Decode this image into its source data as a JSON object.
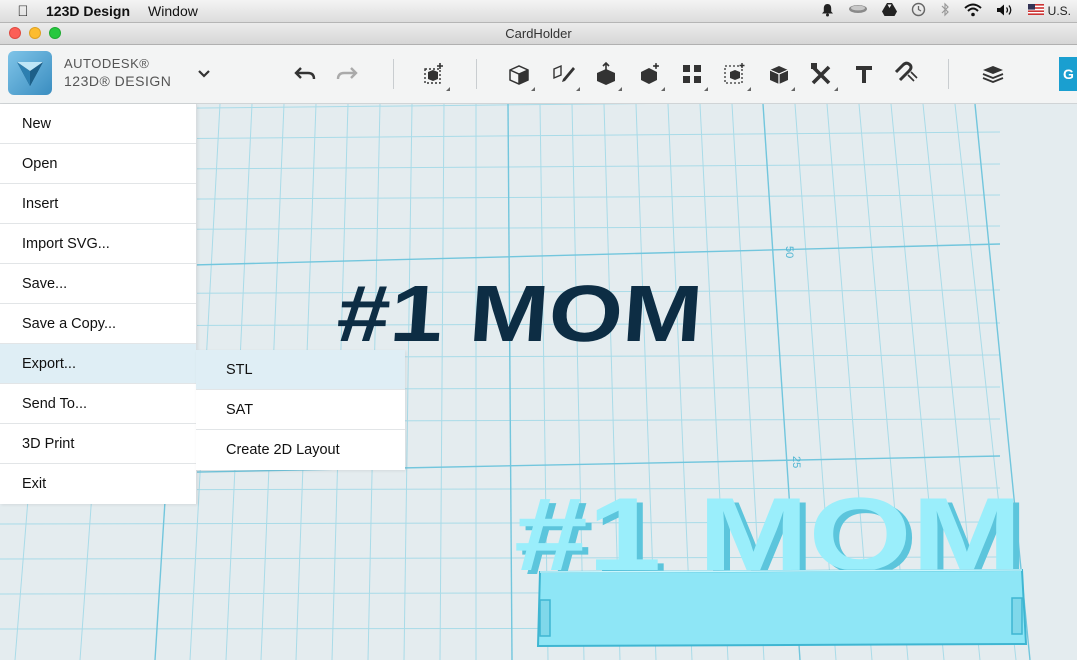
{
  "menubar": {
    "app_name": "123D Design",
    "items": [
      "Window"
    ],
    "input_source": "U.S."
  },
  "window": {
    "title": "CardHolder"
  },
  "brand": {
    "line1": "AUTODESK®",
    "line2": "123D® DESIGN"
  },
  "toolbar": {
    "get_label": "G"
  },
  "main_menu": {
    "items": [
      {
        "label": "New"
      },
      {
        "label": "Open"
      },
      {
        "label": "Insert"
      },
      {
        "label": "Import SVG..."
      },
      {
        "label": "Save..."
      },
      {
        "label": "Save a Copy..."
      },
      {
        "label": "Export...",
        "active": true
      },
      {
        "label": "Send To..."
      },
      {
        "label": "3D Print"
      },
      {
        "label": "Exit"
      }
    ]
  },
  "export_submenu": {
    "items": [
      {
        "label": "STL",
        "active": true
      },
      {
        "label": "SAT"
      },
      {
        "label": "Create 2D Layout"
      }
    ]
  },
  "scene": {
    "sketch_text": "#1 MOM",
    "solid_text": "#1 MOM",
    "grid_label_50": "50",
    "grid_label_25": "25",
    "colors": {
      "sketch_text": "#0d2d44",
      "solid": "#8fe8f6",
      "grid_minor": "#a9dbe8",
      "grid_major": "#72c6dd",
      "accent": "#1a9fd0"
    }
  }
}
